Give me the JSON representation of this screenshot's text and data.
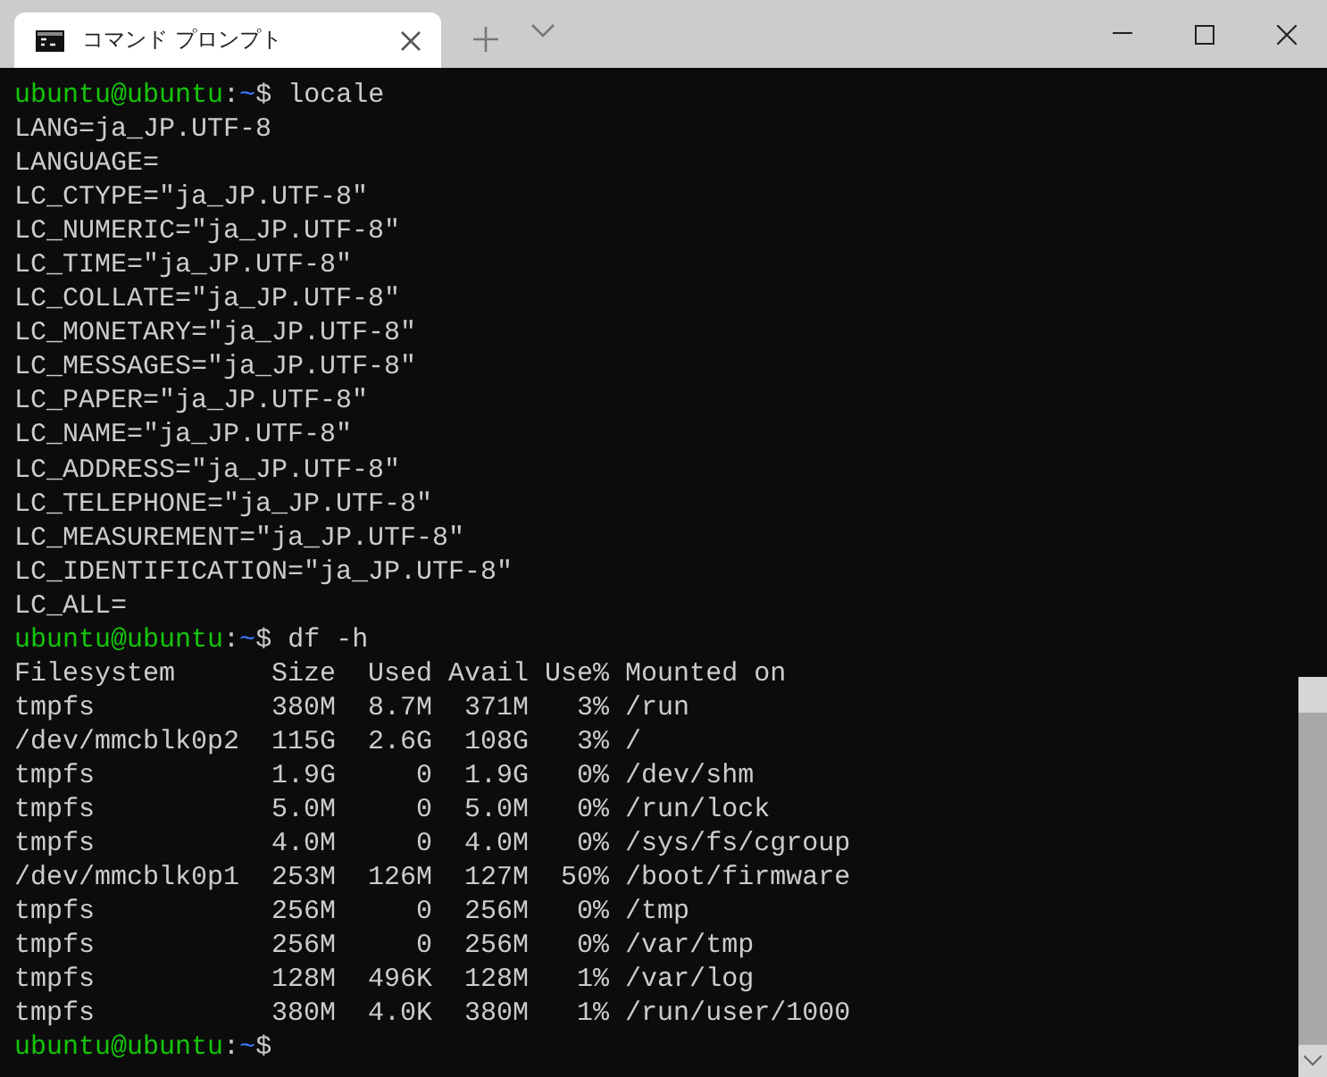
{
  "tab": {
    "title": "コマンド プロンプト",
    "selected": true
  },
  "lines": [
    {
      "kind": "prompt",
      "user": "ubuntu@ubuntu",
      "separator": ":",
      "path": "~",
      "symbol": "$",
      "command": "locale"
    },
    {
      "kind": "output",
      "text": "LANG=ja_JP.UTF-8"
    },
    {
      "kind": "output",
      "text": "LANGUAGE="
    },
    {
      "kind": "output",
      "text": "LC_CTYPE=\"ja_JP.UTF-8\""
    },
    {
      "kind": "output",
      "text": "LC_NUMERIC=\"ja_JP.UTF-8\""
    },
    {
      "kind": "output",
      "text": "LC_TIME=\"ja_JP.UTF-8\""
    },
    {
      "kind": "output",
      "text": "LC_COLLATE=\"ja_JP.UTF-8\""
    },
    {
      "kind": "output",
      "text": "LC_MONETARY=\"ja_JP.UTF-8\""
    },
    {
      "kind": "output",
      "text": "LC_MESSAGES=\"ja_JP.UTF-8\""
    },
    {
      "kind": "output",
      "text": "LC_PAPER=\"ja_JP.UTF-8\""
    },
    {
      "kind": "output",
      "text": "LC_NAME=\"ja_JP.UTF-8\""
    },
    {
      "kind": "output",
      "text": "LC_ADDRESS=\"ja_JP.UTF-8\""
    },
    {
      "kind": "output",
      "text": "LC_TELEPHONE=\"ja_JP.UTF-8\""
    },
    {
      "kind": "output",
      "text": "LC_MEASUREMENT=\"ja_JP.UTF-8\""
    },
    {
      "kind": "output",
      "text": "LC_IDENTIFICATION=\"ja_JP.UTF-8\""
    },
    {
      "kind": "output",
      "text": "LC_ALL="
    },
    {
      "kind": "prompt",
      "user": "ubuntu@ubuntu",
      "separator": ":",
      "path": "~",
      "symbol": "$",
      "command": "df -h"
    },
    {
      "kind": "output",
      "text": "Filesystem      Size  Used Avail Use% Mounted on"
    },
    {
      "kind": "output",
      "text": "tmpfs           380M  8.7M  371M   3% /run"
    },
    {
      "kind": "output",
      "text": "/dev/mmcblk0p2  115G  2.6G  108G   3% /"
    },
    {
      "kind": "output",
      "text": "tmpfs           1.9G     0  1.9G   0% /dev/shm"
    },
    {
      "kind": "output",
      "text": "tmpfs           5.0M     0  5.0M   0% /run/lock"
    },
    {
      "kind": "output",
      "text": "tmpfs           4.0M     0  4.0M   0% /sys/fs/cgroup"
    },
    {
      "kind": "output",
      "text": "/dev/mmcblk0p1  253M  126M  127M  50% /boot/firmware"
    },
    {
      "kind": "output",
      "text": "tmpfs           256M     0  256M   0% /tmp"
    },
    {
      "kind": "output",
      "text": "tmpfs           256M     0  256M   0% /var/tmp"
    },
    {
      "kind": "output",
      "text": "tmpfs           128M  496K  128M   1% /var/log"
    },
    {
      "kind": "output",
      "text": "tmpfs           380M  4.0K  380M   1% /run/user/1000"
    },
    {
      "kind": "prompt",
      "user": "ubuntu@ubuntu",
      "separator": ":",
      "path": "~",
      "symbol": "$"
    }
  ]
}
